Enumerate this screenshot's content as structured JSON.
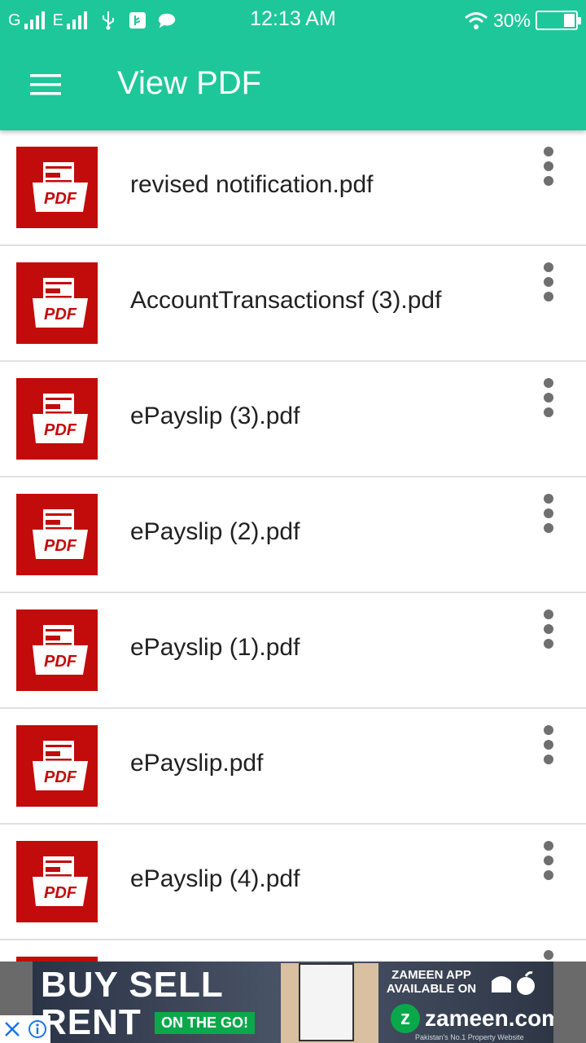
{
  "status_bar": {
    "net1": "G",
    "net2": "E",
    "time": "12:13 AM",
    "battery_percent": "30%",
    "battery_level": 0.3
  },
  "app_bar": {
    "title": "View PDF",
    "menu_icon": "hamburger-menu-icon",
    "background_color": "#1ec799"
  },
  "files": [
    {
      "name": "revised notification.pdf",
      "thumb_label": "PDF"
    },
    {
      "name": "AccountTransactionsf (3).pdf",
      "thumb_label": "PDF"
    },
    {
      "name": "ePayslip (3).pdf",
      "thumb_label": "PDF"
    },
    {
      "name": "ePayslip (2).pdf",
      "thumb_label": "PDF"
    },
    {
      "name": "ePayslip (1).pdf",
      "thumb_label": "PDF"
    },
    {
      "name": "ePayslip.pdf",
      "thumb_label": "PDF"
    },
    {
      "name": "ePayslip (4).pdf",
      "thumb_label": "PDF"
    }
  ],
  "file_icon": "pdf-file-icon",
  "file_icon_color": "#c20b0b",
  "row_menu_icon": "more-vert-icon",
  "ad": {
    "line1": "BUY SELL",
    "line2": "RENT",
    "tag": "ON THE GO!",
    "promo": "ZAMEEN APP AVAILABLE ON",
    "platforms_icon": "android-apple-icon",
    "brand": "zameen.com",
    "strap": "Pakistan's No.1 Property Website",
    "close_icon": "close-icon",
    "info_icon": "info-icon"
  }
}
